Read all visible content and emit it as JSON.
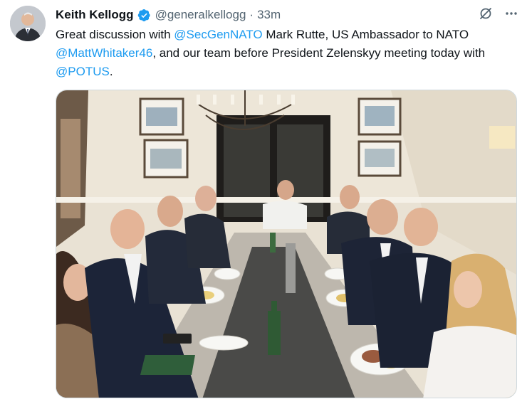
{
  "author": {
    "name": "Keith Kellogg",
    "handle": "@generalkellogg",
    "separator": "·",
    "time": "33m",
    "verified_color": "#1d9bf0"
  },
  "tweet": {
    "text_parts": [
      {
        "text": "Great discussion with ",
        "mention": false
      },
      {
        "text": "@SecGenNATO",
        "mention": true
      },
      {
        "text": " Mark Rutte, US Ambassador to NATO ",
        "mention": false
      },
      {
        "text": "@MattWhitaker46",
        "mention": true
      },
      {
        "text": ", and our team before President Zelenskyy meeting today with ",
        "mention": false
      },
      {
        "text": "@POTUS",
        "mention": true
      },
      {
        "text": ".",
        "mention": false
      }
    ]
  },
  "icons": {
    "grok": "grok-icon",
    "more": "more-icon",
    "verified": "verified-badge-icon"
  },
  "colors": {
    "text": "#0f1419",
    "secondary": "#536471",
    "link": "#1d9bf0"
  }
}
